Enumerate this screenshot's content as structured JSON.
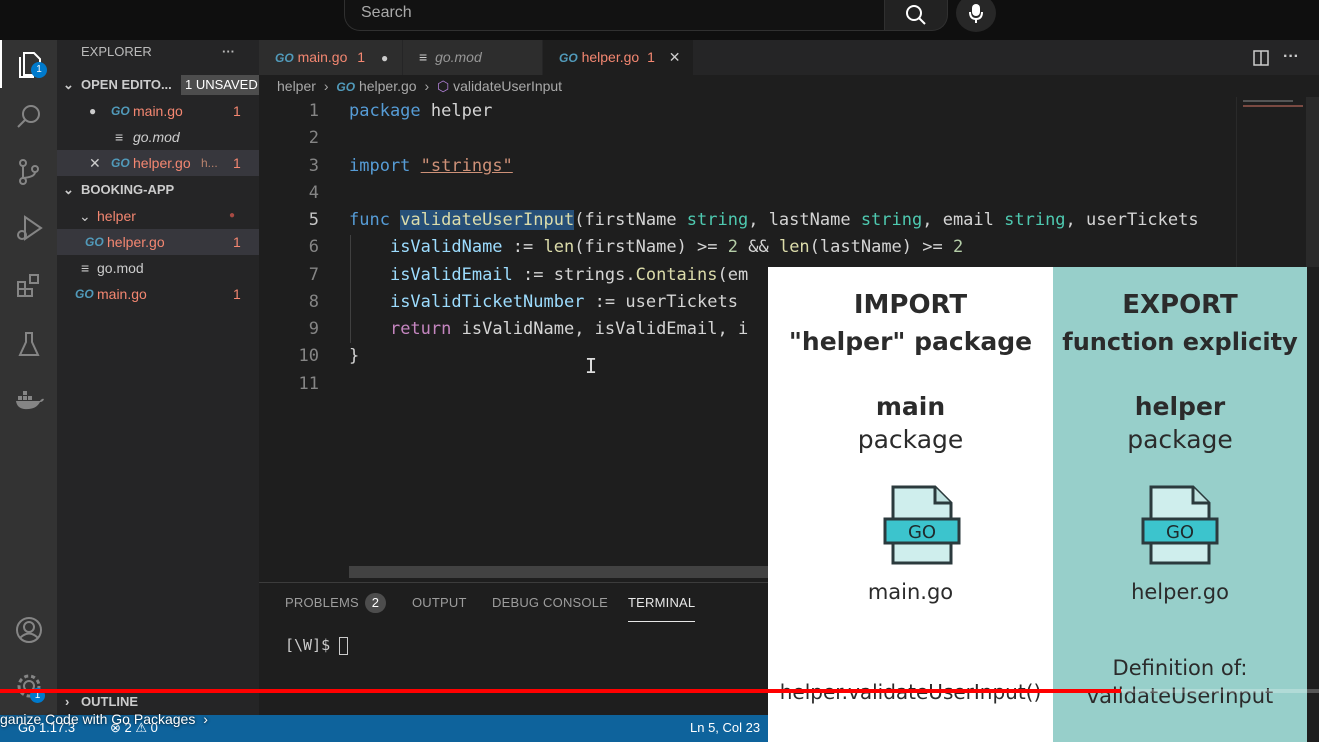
{
  "youtube": {
    "search_placeholder": "Search",
    "chapter_title": "ganize Code with Go Packages",
    "progress": 0.85
  },
  "explorer": {
    "title": "EXPLORER",
    "more": "···",
    "open_editors_label": "OPEN EDITO...",
    "unsaved_badge": "1 UNSAVED",
    "open_editors": [
      {
        "icon": "GO",
        "name": "main.go",
        "count": "1"
      },
      {
        "icon": "≡",
        "name": "go.mod"
      },
      {
        "icon": "GO",
        "name": "helper.go",
        "suffix": "h...",
        "count": "1"
      }
    ],
    "project_label": "BOOKING-APP",
    "folder": "helper",
    "files": [
      {
        "icon": "GO",
        "name": "helper.go",
        "count": "1"
      },
      {
        "icon": "≡",
        "name": "go.mod"
      },
      {
        "icon": "GO",
        "name": "main.go",
        "count": "1"
      }
    ],
    "outline_label": "OUTLINE",
    "activity_badge": "1",
    "settings_badge": "1"
  },
  "tabs": [
    {
      "icon": "GO",
      "name": "main.go",
      "count": "1",
      "modified": "●"
    },
    {
      "icon": "≡",
      "name": "go.mod"
    },
    {
      "icon": "GO",
      "name": "helper.go",
      "count": "1",
      "close": "✕"
    }
  ],
  "breadcrumb": {
    "folder": "helper",
    "sep": "›",
    "file_icon": "GO",
    "file": "helper.go",
    "symbol": "validateUserInput"
  },
  "code": {
    "lines": [
      "1",
      "2",
      "3",
      "4",
      "5",
      "6",
      "7",
      "8",
      "9",
      "10",
      "11"
    ],
    "l1_kw": "package",
    "l1_rest": " helper",
    "l3_kw": "import",
    "l3_str": "\"strings\"",
    "l5_kw": "func",
    "l5_fn": "validateUserInput",
    "l5_p1": "(firstName ",
    "l5_t": "string",
    "l5_p2": ", lastName ",
    "l5_p3": ", email ",
    "l5_p4": ", userTickets",
    "l6_var": "isValidName",
    "l6_op": " := ",
    "l6_len": "len",
    "l6_a": "(firstName) >= ",
    "l6_n": "2",
    "l6_b": " && ",
    "l6_c": "(lastName) >= ",
    "l7_var": "isValidEmail",
    "l7_a": " := strings.",
    "l7_fn": "Contains",
    "l7_b": "(em",
    "l8_var": "isValidTicketNumber",
    "l8_a": " := userTickets ",
    "l9_kw": "return",
    "l9_a": " isValidName, isValidEmail, i",
    "l10": "}"
  },
  "panel": {
    "problems": "PROBLEMS",
    "problems_count": "2",
    "output": "OUTPUT",
    "debug": "DEBUG CONSOLE",
    "terminal": "TERMINAL",
    "prompt": "[\\W]$ "
  },
  "statusbar": {
    "go_version": "Go 1.17.3",
    "errors": "⊗ 2 ⚠ 0",
    "cursor": "Ln 5, Col 23"
  },
  "overlay": {
    "left_h1": "IMPORT",
    "left_h2": "\"helper\" package",
    "left_m1": "main",
    "left_m2": "package",
    "left_file_icon": "GO",
    "left_file": "main.go",
    "left_footer": "helper.validateUserInput()",
    "right_h1": "EXPORT",
    "right_h2": "function explicity",
    "right_m1": "helper",
    "right_m2": "package",
    "right_file_icon": "GO",
    "right_file": "helper.go",
    "right_footer1": "Definition of:",
    "right_footer2": "validateUserInput"
  }
}
